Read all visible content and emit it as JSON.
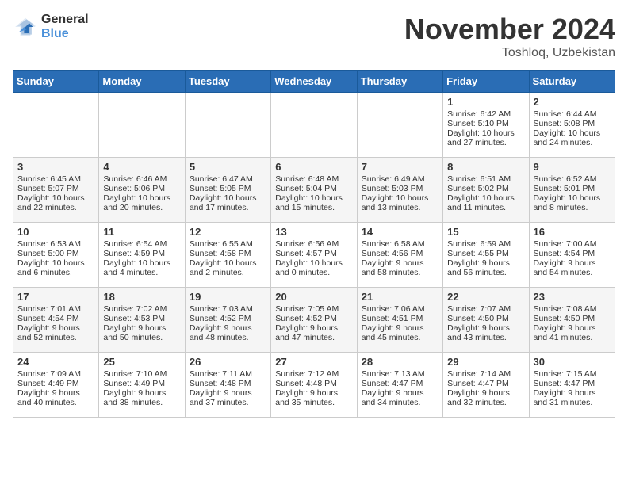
{
  "header": {
    "logo_general": "General",
    "logo_blue": "Blue",
    "month_title": "November 2024",
    "location": "Toshloq, Uzbekistan"
  },
  "days_of_week": [
    "Sunday",
    "Monday",
    "Tuesday",
    "Wednesday",
    "Thursday",
    "Friday",
    "Saturday"
  ],
  "weeks": [
    [
      {
        "day": "",
        "info": ""
      },
      {
        "day": "",
        "info": ""
      },
      {
        "day": "",
        "info": ""
      },
      {
        "day": "",
        "info": ""
      },
      {
        "day": "",
        "info": ""
      },
      {
        "day": "1",
        "info": "Sunrise: 6:42 AM\nSunset: 5:10 PM\nDaylight: 10 hours and 27 minutes."
      },
      {
        "day": "2",
        "info": "Sunrise: 6:44 AM\nSunset: 5:08 PM\nDaylight: 10 hours and 24 minutes."
      }
    ],
    [
      {
        "day": "3",
        "info": "Sunrise: 6:45 AM\nSunset: 5:07 PM\nDaylight: 10 hours and 22 minutes."
      },
      {
        "day": "4",
        "info": "Sunrise: 6:46 AM\nSunset: 5:06 PM\nDaylight: 10 hours and 20 minutes."
      },
      {
        "day": "5",
        "info": "Sunrise: 6:47 AM\nSunset: 5:05 PM\nDaylight: 10 hours and 17 minutes."
      },
      {
        "day": "6",
        "info": "Sunrise: 6:48 AM\nSunset: 5:04 PM\nDaylight: 10 hours and 15 minutes."
      },
      {
        "day": "7",
        "info": "Sunrise: 6:49 AM\nSunset: 5:03 PM\nDaylight: 10 hours and 13 minutes."
      },
      {
        "day": "8",
        "info": "Sunrise: 6:51 AM\nSunset: 5:02 PM\nDaylight: 10 hours and 11 minutes."
      },
      {
        "day": "9",
        "info": "Sunrise: 6:52 AM\nSunset: 5:01 PM\nDaylight: 10 hours and 8 minutes."
      }
    ],
    [
      {
        "day": "10",
        "info": "Sunrise: 6:53 AM\nSunset: 5:00 PM\nDaylight: 10 hours and 6 minutes."
      },
      {
        "day": "11",
        "info": "Sunrise: 6:54 AM\nSunset: 4:59 PM\nDaylight: 10 hours and 4 minutes."
      },
      {
        "day": "12",
        "info": "Sunrise: 6:55 AM\nSunset: 4:58 PM\nDaylight: 10 hours and 2 minutes."
      },
      {
        "day": "13",
        "info": "Sunrise: 6:56 AM\nSunset: 4:57 PM\nDaylight: 10 hours and 0 minutes."
      },
      {
        "day": "14",
        "info": "Sunrise: 6:58 AM\nSunset: 4:56 PM\nDaylight: 9 hours and 58 minutes."
      },
      {
        "day": "15",
        "info": "Sunrise: 6:59 AM\nSunset: 4:55 PM\nDaylight: 9 hours and 56 minutes."
      },
      {
        "day": "16",
        "info": "Sunrise: 7:00 AM\nSunset: 4:54 PM\nDaylight: 9 hours and 54 minutes."
      }
    ],
    [
      {
        "day": "17",
        "info": "Sunrise: 7:01 AM\nSunset: 4:54 PM\nDaylight: 9 hours and 52 minutes."
      },
      {
        "day": "18",
        "info": "Sunrise: 7:02 AM\nSunset: 4:53 PM\nDaylight: 9 hours and 50 minutes."
      },
      {
        "day": "19",
        "info": "Sunrise: 7:03 AM\nSunset: 4:52 PM\nDaylight: 9 hours and 48 minutes."
      },
      {
        "day": "20",
        "info": "Sunrise: 7:05 AM\nSunset: 4:52 PM\nDaylight: 9 hours and 47 minutes."
      },
      {
        "day": "21",
        "info": "Sunrise: 7:06 AM\nSunset: 4:51 PM\nDaylight: 9 hours and 45 minutes."
      },
      {
        "day": "22",
        "info": "Sunrise: 7:07 AM\nSunset: 4:50 PM\nDaylight: 9 hours and 43 minutes."
      },
      {
        "day": "23",
        "info": "Sunrise: 7:08 AM\nSunset: 4:50 PM\nDaylight: 9 hours and 41 minutes."
      }
    ],
    [
      {
        "day": "24",
        "info": "Sunrise: 7:09 AM\nSunset: 4:49 PM\nDaylight: 9 hours and 40 minutes."
      },
      {
        "day": "25",
        "info": "Sunrise: 7:10 AM\nSunset: 4:49 PM\nDaylight: 9 hours and 38 minutes."
      },
      {
        "day": "26",
        "info": "Sunrise: 7:11 AM\nSunset: 4:48 PM\nDaylight: 9 hours and 37 minutes."
      },
      {
        "day": "27",
        "info": "Sunrise: 7:12 AM\nSunset: 4:48 PM\nDaylight: 9 hours and 35 minutes."
      },
      {
        "day": "28",
        "info": "Sunrise: 7:13 AM\nSunset: 4:47 PM\nDaylight: 9 hours and 34 minutes."
      },
      {
        "day": "29",
        "info": "Sunrise: 7:14 AM\nSunset: 4:47 PM\nDaylight: 9 hours and 32 minutes."
      },
      {
        "day": "30",
        "info": "Sunrise: 7:15 AM\nSunset: 4:47 PM\nDaylight: 9 hours and 31 minutes."
      }
    ]
  ]
}
